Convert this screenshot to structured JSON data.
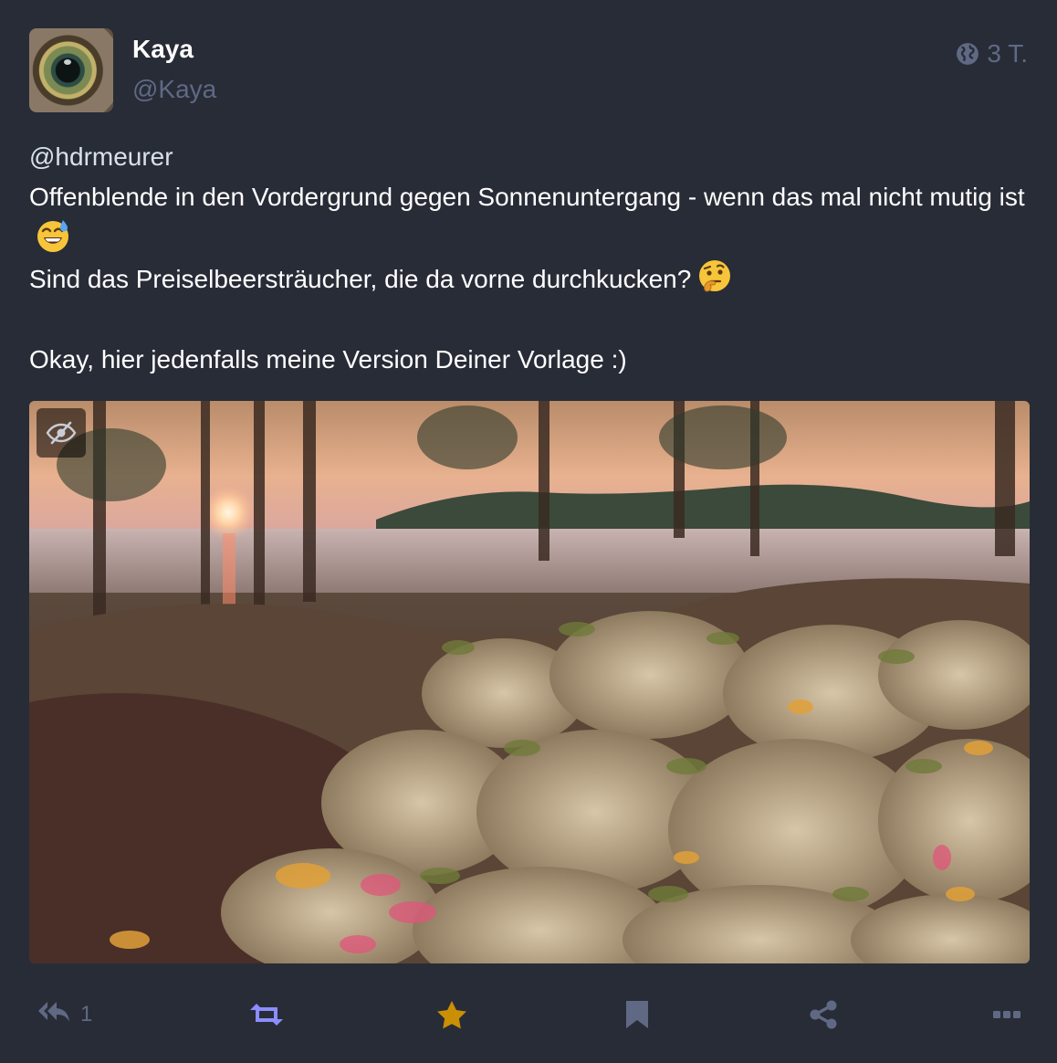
{
  "post": {
    "display_name": "Kaya",
    "handle": "@Kaya",
    "visibility_icon": "globe-icon",
    "time": "3 T.",
    "content": {
      "mention": "@hdrmeurer",
      "line1": "Offenblende in den Vordergrund gegen Sonnenuntergang - wenn das mal nicht mutig ist",
      "emoji1": "sweat-smile-emoji",
      "line2": "Sind das Preiselbeersträucher, die da vorne durchkucken?",
      "emoji2": "thinking-face-emoji",
      "line3": "Okay, hier jedenfalls meine Version Deiner Vorlage :)"
    },
    "media": {
      "hide_icon": "eye-slash-icon"
    },
    "actions": {
      "reply_icon": "reply-all-icon",
      "reply_count": "1",
      "boost_icon": "retweet-icon",
      "favourite_icon": "star-icon",
      "bookmark_icon": "bookmark-icon",
      "share_icon": "share-icon",
      "more_icon": "ellipsis-icon"
    },
    "colors": {
      "background": "#282c37",
      "muted": "#606984",
      "boost_active": "#8c8dff",
      "favourite_active": "#ca8f04"
    }
  }
}
